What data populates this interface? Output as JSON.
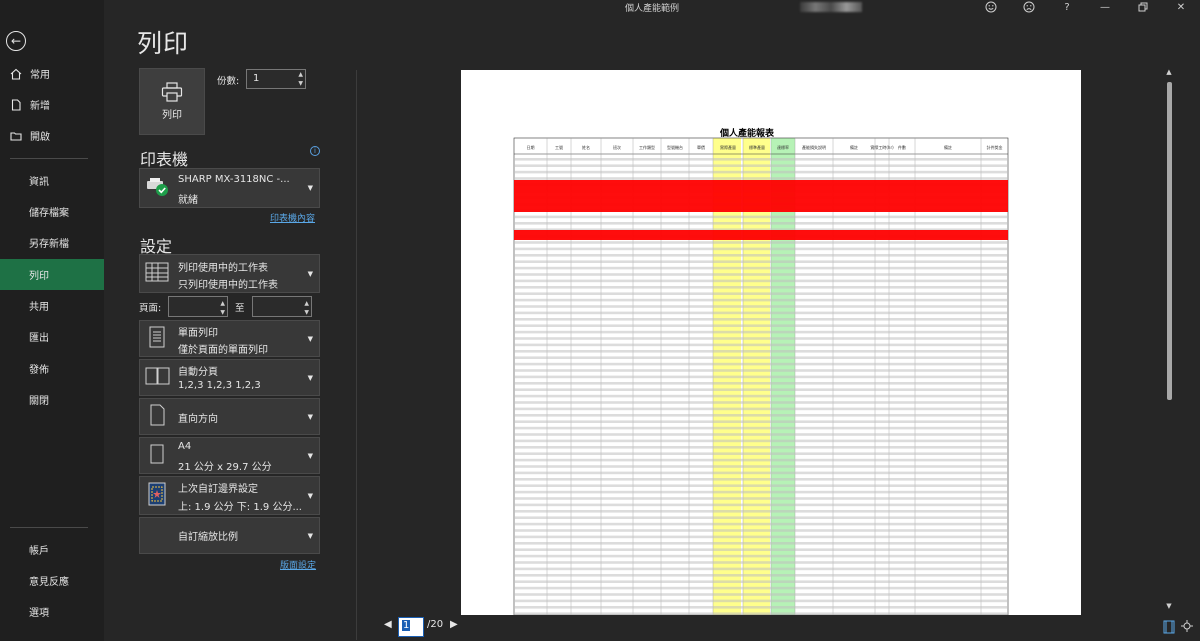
{
  "window": {
    "doc_title": "個人產能範例",
    "title_icons": [
      "smiley-icon",
      "frown-icon",
      "help-icon",
      "minimize-icon",
      "restore-icon",
      "close-icon"
    ]
  },
  "nav": {
    "top_items": [
      {
        "label": "常用",
        "icon": "home-icon"
      },
      {
        "label": "新增",
        "icon": "new-file-icon"
      },
      {
        "label": "開啟",
        "icon": "folder-icon"
      }
    ],
    "mid_items": [
      "資訊",
      "儲存檔案",
      "另存新檔",
      "列印",
      "共用",
      "匯出",
      "發佈",
      "關閉"
    ],
    "active": "列印",
    "bottom_items": [
      "帳戶",
      "意見反應",
      "選項"
    ]
  },
  "print": {
    "title": "列印",
    "print_button_label": "列印",
    "copies_label": "份數:",
    "copies_value": "1",
    "printer_header": "印表機",
    "printer_name": "SHARP MX-3118NC -...",
    "printer_status": "就緒",
    "printer_props_link": "印表機內容",
    "settings_header": "設定",
    "settings": [
      {
        "line1": "列印使用中的工作表",
        "line2": "只列印使用中的工作表",
        "icon": "sheet-grid-icon"
      },
      {
        "line1": "單面列印",
        "line2": "僅於頁面的單面列印",
        "icon": "one-sided-icon"
      },
      {
        "line1": "自動分頁",
        "line2": "1,2,3    1,2,3    1,2,3",
        "icon": "collate-icon"
      },
      {
        "line1": "直向方向",
        "line2": "",
        "icon": "portrait-icon"
      },
      {
        "line1": "A4",
        "line2": "21 公分 x 29.7 公分",
        "icon": "paper-size-icon"
      },
      {
        "line1": "上次自訂邊界設定",
        "line2": "上: 1.9 公分 下: 1.9 公分...",
        "icon": "margins-icon"
      },
      {
        "line1": "自訂縮放比例",
        "line2": "",
        "icon": "scaling-icon"
      }
    ],
    "pages_label": "頁面:",
    "pages_to": "至",
    "page_setup_link": "版面設定"
  },
  "preview": {
    "report_title": "個人產能報表",
    "headers": [
      "日期",
      "工號",
      "姓名",
      "班次",
      "工作類型",
      "型號機台",
      "單價",
      "實際產量",
      "標準產量",
      "達標率",
      "產能損失說明",
      "備註",
      "實際工時(hr)",
      "件數",
      "備註",
      "計件獎金"
    ],
    "current_page": "1",
    "total_pages": "/20"
  },
  "colors": {
    "accent": "#1e7145",
    "link": "#5aa8e8",
    "highlight_red": "#ff0000",
    "highlight_yellow": "#ffff8c",
    "highlight_green": "#b6f2b6"
  }
}
